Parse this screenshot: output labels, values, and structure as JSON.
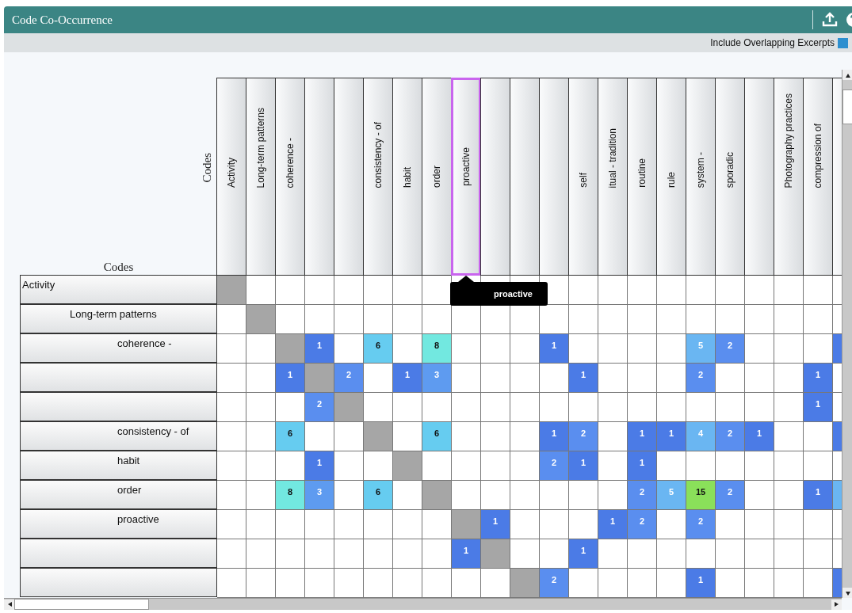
{
  "window": {
    "title": "Code Co-Occurrence"
  },
  "toolbar": {
    "include_overlapping": {
      "label": "Include Overlapping Excerpts",
      "checked": true
    }
  },
  "matrix": {
    "row_axis_label": "Codes",
    "column_axis_label": "Codes",
    "tooltip": "proactive",
    "columns": [
      {
        "label": "Activity",
        "selected": false
      },
      {
        "label": "Long-term patterns",
        "selected": false
      },
      {
        "label": "coherence -",
        "selected": false
      },
      {
        "selected": false
      },
      {
        "selected": false
      },
      {
        "label": "consistency - of",
        "selected": false
      },
      {
        "label": "habit",
        "selected": false
      },
      {
        "label": "order",
        "selected": false
      },
      {
        "label": "proactive",
        "selected": true
      },
      {
        "selected": false
      },
      {
        "selected": false
      },
      {
        "selected": false
      },
      {
        "label": "self",
        "selected": false
      },
      {
        "label": "itual - tradition",
        "selected": false
      },
      {
        "label": "routine",
        "selected": false
      },
      {
        "label": "rule",
        "selected": false
      },
      {
        "label": "system -",
        "selected": false
      },
      {
        "label": "sporadic",
        "selected": false
      },
      {
        "selected": false
      },
      {
        "label": "Photography practices",
        "selected": false
      },
      {
        "label": "compression of",
        "selected": false
      },
      {
        "selected": false
      }
    ],
    "rows": [
      {
        "label": "Activity",
        "cells": [
          {
            "kind": "self"
          },
          {
            "kind": "empty"
          },
          {
            "kind": "empty"
          },
          {
            "kind": "empty"
          },
          {
            "kind": "empty"
          },
          {
            "kind": "empty"
          },
          {
            "kind": "empty"
          },
          {
            "kind": "empty"
          },
          {
            "kind": "empty"
          },
          {
            "kind": "empty"
          },
          {
            "kind": "empty"
          },
          {
            "kind": "empty"
          },
          {
            "kind": "empty"
          },
          {
            "kind": "empty"
          },
          {
            "kind": "empty"
          },
          {
            "kind": "empty"
          },
          {
            "kind": "empty"
          },
          {
            "kind": "empty"
          },
          {
            "kind": "empty"
          },
          {
            "kind": "empty"
          },
          {
            "kind": "empty"
          },
          {
            "kind": "empty"
          }
        ],
        "children": [
          {
            "label": "Long-term patterns",
            "cells": [
              {
                "kind": "empty"
              },
              {
                "kind": "self"
              },
              {
                "kind": "empty"
              },
              {
                "kind": "empty"
              },
              {
                "kind": "empty"
              },
              {
                "kind": "empty"
              },
              {
                "kind": "empty"
              },
              {
                "kind": "empty"
              },
              {
                "kind": "empty"
              },
              {
                "kind": "empty"
              },
              {
                "kind": "empty"
              },
              {
                "kind": "empty"
              },
              {
                "kind": "empty"
              },
              {
                "kind": "empty"
              },
              {
                "kind": "empty"
              },
              {
                "kind": "empty"
              },
              {
                "kind": "empty"
              },
              {
                "kind": "empty"
              },
              {
                "kind": "empty"
              },
              {
                "kind": "empty"
              },
              {
                "kind": "empty"
              },
              {
                "kind": "empty"
              }
            ],
            "children": [
              {
                "label": "coherence -",
                "cells": [
                  {
                    "kind": "empty"
                  },
                  {
                    "kind": "empty"
                  },
                  {
                    "kind": "self"
                  },
                  {
                    "kind": "count",
                    "value": "1",
                    "color": "#4b7be6"
                  },
                  {
                    "kind": "empty"
                  },
                  {
                    "kind": "count",
                    "value": "6",
                    "color": "#66ccf0"
                  },
                  {
                    "kind": "empty"
                  },
                  {
                    "kind": "count",
                    "value": "8",
                    "color": "#72e8e0"
                  },
                  {
                    "kind": "empty"
                  },
                  {
                    "kind": "empty"
                  },
                  {
                    "kind": "empty"
                  },
                  {
                    "kind": "count",
                    "value": "1",
                    "color": "#4b7be6"
                  },
                  {
                    "kind": "empty"
                  },
                  {
                    "kind": "empty"
                  },
                  {
                    "kind": "empty"
                  },
                  {
                    "kind": "empty"
                  },
                  {
                    "kind": "count",
                    "value": "5",
                    "color": "#6ab6f2"
                  },
                  {
                    "kind": "count",
                    "value": "2",
                    "color": "#5a8eef"
                  },
                  {
                    "kind": "empty"
                  },
                  {
                    "kind": "empty"
                  },
                  {
                    "kind": "empty"
                  },
                  {
                    "kind": "count",
                    "color": "#4b7be6"
                  }
                ]
              },
              {
                "cells": [
                  {
                    "kind": "empty"
                  },
                  {
                    "kind": "empty"
                  },
                  {
                    "kind": "count",
                    "value": "1",
                    "color": "#4b7be6"
                  },
                  {
                    "kind": "self"
                  },
                  {
                    "kind": "count",
                    "value": "2",
                    "color": "#5a8eef"
                  },
                  {
                    "kind": "empty"
                  },
                  {
                    "kind": "count",
                    "value": "1",
                    "color": "#4b7be6"
                  },
                  {
                    "kind": "count",
                    "value": "3",
                    "color": "#5e9bf0"
                  },
                  {
                    "kind": "empty"
                  },
                  {
                    "kind": "empty"
                  },
                  {
                    "kind": "empty"
                  },
                  {
                    "kind": "empty"
                  },
                  {
                    "kind": "count",
                    "value": "1",
                    "color": "#4b7be6"
                  },
                  {
                    "kind": "empty"
                  },
                  {
                    "kind": "empty"
                  },
                  {
                    "kind": "empty"
                  },
                  {
                    "kind": "count",
                    "value": "2",
                    "color": "#5a8eef"
                  },
                  {
                    "kind": "empty"
                  },
                  {
                    "kind": "empty"
                  },
                  {
                    "kind": "empty"
                  },
                  {
                    "kind": "count",
                    "value": "1",
                    "color": "#4b7be6"
                  },
                  {
                    "kind": "empty"
                  }
                ]
              },
              {
                "cells": [
                  {
                    "kind": "empty"
                  },
                  {
                    "kind": "empty"
                  },
                  {
                    "kind": "empty"
                  },
                  {
                    "kind": "count",
                    "value": "2",
                    "color": "#5a8eef"
                  },
                  {
                    "kind": "self"
                  },
                  {
                    "kind": "empty"
                  },
                  {
                    "kind": "empty"
                  },
                  {
                    "kind": "empty"
                  },
                  {
                    "kind": "empty"
                  },
                  {
                    "kind": "empty"
                  },
                  {
                    "kind": "empty"
                  },
                  {
                    "kind": "empty"
                  },
                  {
                    "kind": "empty"
                  },
                  {
                    "kind": "empty"
                  },
                  {
                    "kind": "empty"
                  },
                  {
                    "kind": "empty"
                  },
                  {
                    "kind": "empty"
                  },
                  {
                    "kind": "empty"
                  },
                  {
                    "kind": "empty"
                  },
                  {
                    "kind": "empty"
                  },
                  {
                    "kind": "count",
                    "value": "1",
                    "color": "#4b7be6"
                  },
                  {
                    "kind": "empty"
                  }
                ]
              },
              {
                "label": "consistency - of",
                "cells": [
                  {
                    "kind": "empty"
                  },
                  {
                    "kind": "empty"
                  },
                  {
                    "kind": "count",
                    "value": "6",
                    "color": "#66ccf0"
                  },
                  {
                    "kind": "empty"
                  },
                  {
                    "kind": "empty"
                  },
                  {
                    "kind": "self"
                  },
                  {
                    "kind": "empty"
                  },
                  {
                    "kind": "count",
                    "value": "6",
                    "color": "#66ccf0"
                  },
                  {
                    "kind": "empty"
                  },
                  {
                    "kind": "empty"
                  },
                  {
                    "kind": "empty"
                  },
                  {
                    "kind": "count",
                    "value": "1",
                    "color": "#4b7be6"
                  },
                  {
                    "kind": "count",
                    "value": "2",
                    "color": "#5a8eef"
                  },
                  {
                    "kind": "empty"
                  },
                  {
                    "kind": "count",
                    "value": "1",
                    "color": "#4b7be6"
                  },
                  {
                    "kind": "count",
                    "value": "1",
                    "color": "#4b7be6"
                  },
                  {
                    "kind": "count",
                    "value": "4",
                    "color": "#6ab6f2"
                  },
                  {
                    "kind": "count",
                    "value": "2",
                    "color": "#5a8eef"
                  },
                  {
                    "kind": "count",
                    "value": "1",
                    "color": "#4b7be6"
                  },
                  {
                    "kind": "empty"
                  },
                  {
                    "kind": "empty"
                  },
                  {
                    "kind": "count",
                    "color": "#4b7be6"
                  }
                ]
              },
              {
                "label": "habit",
                "cells": [
                  {
                    "kind": "empty"
                  },
                  {
                    "kind": "empty"
                  },
                  {
                    "kind": "empty"
                  },
                  {
                    "kind": "count",
                    "value": "1",
                    "color": "#4b7be6"
                  },
                  {
                    "kind": "empty"
                  },
                  {
                    "kind": "empty"
                  },
                  {
                    "kind": "self"
                  },
                  {
                    "kind": "empty"
                  },
                  {
                    "kind": "empty"
                  },
                  {
                    "kind": "empty"
                  },
                  {
                    "kind": "empty"
                  },
                  {
                    "kind": "count",
                    "value": "2",
                    "color": "#5a8eef"
                  },
                  {
                    "kind": "count",
                    "value": "1",
                    "color": "#4b7be6"
                  },
                  {
                    "kind": "empty"
                  },
                  {
                    "kind": "count",
                    "value": "1",
                    "color": "#4b7be6"
                  },
                  {
                    "kind": "empty"
                  },
                  {
                    "kind": "empty"
                  },
                  {
                    "kind": "empty"
                  },
                  {
                    "kind": "empty"
                  },
                  {
                    "kind": "empty"
                  },
                  {
                    "kind": "empty"
                  },
                  {
                    "kind": "empty"
                  }
                ]
              },
              {
                "label": "order",
                "cells": [
                  {
                    "kind": "empty"
                  },
                  {
                    "kind": "empty"
                  },
                  {
                    "kind": "count",
                    "value": "8",
                    "color": "#72e8e0"
                  },
                  {
                    "kind": "count",
                    "value": "3",
                    "color": "#5e9bf0"
                  },
                  {
                    "kind": "empty"
                  },
                  {
                    "kind": "count",
                    "value": "6",
                    "color": "#66ccf0"
                  },
                  {
                    "kind": "empty"
                  },
                  {
                    "kind": "self"
                  },
                  {
                    "kind": "empty"
                  },
                  {
                    "kind": "empty"
                  },
                  {
                    "kind": "empty"
                  },
                  {
                    "kind": "empty"
                  },
                  {
                    "kind": "empty"
                  },
                  {
                    "kind": "empty"
                  },
                  {
                    "kind": "count",
                    "value": "2",
                    "color": "#5a8eef"
                  },
                  {
                    "kind": "count",
                    "value": "5",
                    "color": "#6ab6f2"
                  },
                  {
                    "kind": "count",
                    "value": "15",
                    "color": "#8ae05a"
                  },
                  {
                    "kind": "count",
                    "value": "2",
                    "color": "#5a8eef"
                  },
                  {
                    "kind": "empty"
                  },
                  {
                    "kind": "empty"
                  },
                  {
                    "kind": "count",
                    "value": "1",
                    "color": "#4b7be6"
                  },
                  {
                    "kind": "count",
                    "color": "#6ab6f2"
                  }
                ]
              },
              {
                "label": "proactive",
                "cells": [
                  {
                    "kind": "empty"
                  },
                  {
                    "kind": "empty"
                  },
                  {
                    "kind": "empty"
                  },
                  {
                    "kind": "empty"
                  },
                  {
                    "kind": "empty"
                  },
                  {
                    "kind": "empty"
                  },
                  {
                    "kind": "empty"
                  },
                  {
                    "kind": "empty"
                  },
                  {
                    "kind": "self"
                  },
                  {
                    "kind": "count",
                    "value": "1",
                    "color": "#4b7be6"
                  },
                  {
                    "kind": "empty"
                  },
                  {
                    "kind": "empty"
                  },
                  {
                    "kind": "empty"
                  },
                  {
                    "kind": "count",
                    "value": "1",
                    "color": "#4b7be6"
                  },
                  {
                    "kind": "count",
                    "value": "2",
                    "color": "#5a8eef"
                  },
                  {
                    "kind": "empty"
                  },
                  {
                    "kind": "count",
                    "value": "2",
                    "color": "#5a8eef"
                  },
                  {
                    "kind": "empty"
                  },
                  {
                    "kind": "empty"
                  },
                  {
                    "kind": "empty"
                  },
                  {
                    "kind": "empty"
                  },
                  {
                    "kind": "empty"
                  }
                ]
              },
              {
                "cells": [
                  {
                    "kind": "empty"
                  },
                  {
                    "kind": "empty"
                  },
                  {
                    "kind": "empty"
                  },
                  {
                    "kind": "empty"
                  },
                  {
                    "kind": "empty"
                  },
                  {
                    "kind": "empty"
                  },
                  {
                    "kind": "empty"
                  },
                  {
                    "kind": "empty"
                  },
                  {
                    "kind": "count",
                    "value": "1",
                    "color": "#4b7be6"
                  },
                  {
                    "kind": "self"
                  },
                  {
                    "kind": "empty"
                  },
                  {
                    "kind": "empty"
                  },
                  {
                    "kind": "count",
                    "value": "1",
                    "color": "#4b7be6"
                  },
                  {
                    "kind": "empty"
                  },
                  {
                    "kind": "empty"
                  },
                  {
                    "kind": "empty"
                  },
                  {
                    "kind": "empty"
                  },
                  {
                    "kind": "empty"
                  },
                  {
                    "kind": "empty"
                  },
                  {
                    "kind": "empty"
                  },
                  {
                    "kind": "empty"
                  },
                  {
                    "kind": "empty"
                  }
                ]
              },
              {
                "cells": [
                  {
                    "kind": "empty"
                  },
                  {
                    "kind": "empty"
                  },
                  {
                    "kind": "empty"
                  },
                  {
                    "kind": "empty"
                  },
                  {
                    "kind": "empty"
                  },
                  {
                    "kind": "empty"
                  },
                  {
                    "kind": "empty"
                  },
                  {
                    "kind": "empty"
                  },
                  {
                    "kind": "empty"
                  },
                  {
                    "kind": "empty"
                  },
                  {
                    "kind": "self"
                  },
                  {
                    "kind": "count",
                    "value": "2",
                    "color": "#5a8eef"
                  },
                  {
                    "kind": "empty"
                  },
                  {
                    "kind": "empty"
                  },
                  {
                    "kind": "empty"
                  },
                  {
                    "kind": "empty"
                  },
                  {
                    "kind": "count",
                    "value": "1",
                    "color": "#4b7be6"
                  },
                  {
                    "kind": "empty"
                  },
                  {
                    "kind": "empty"
                  },
                  {
                    "kind": "empty"
                  },
                  {
                    "kind": "empty"
                  },
                  {
                    "kind": "count",
                    "color": "#4b7be6"
                  }
                ]
              }
            ]
          }
        ]
      }
    ]
  }
}
